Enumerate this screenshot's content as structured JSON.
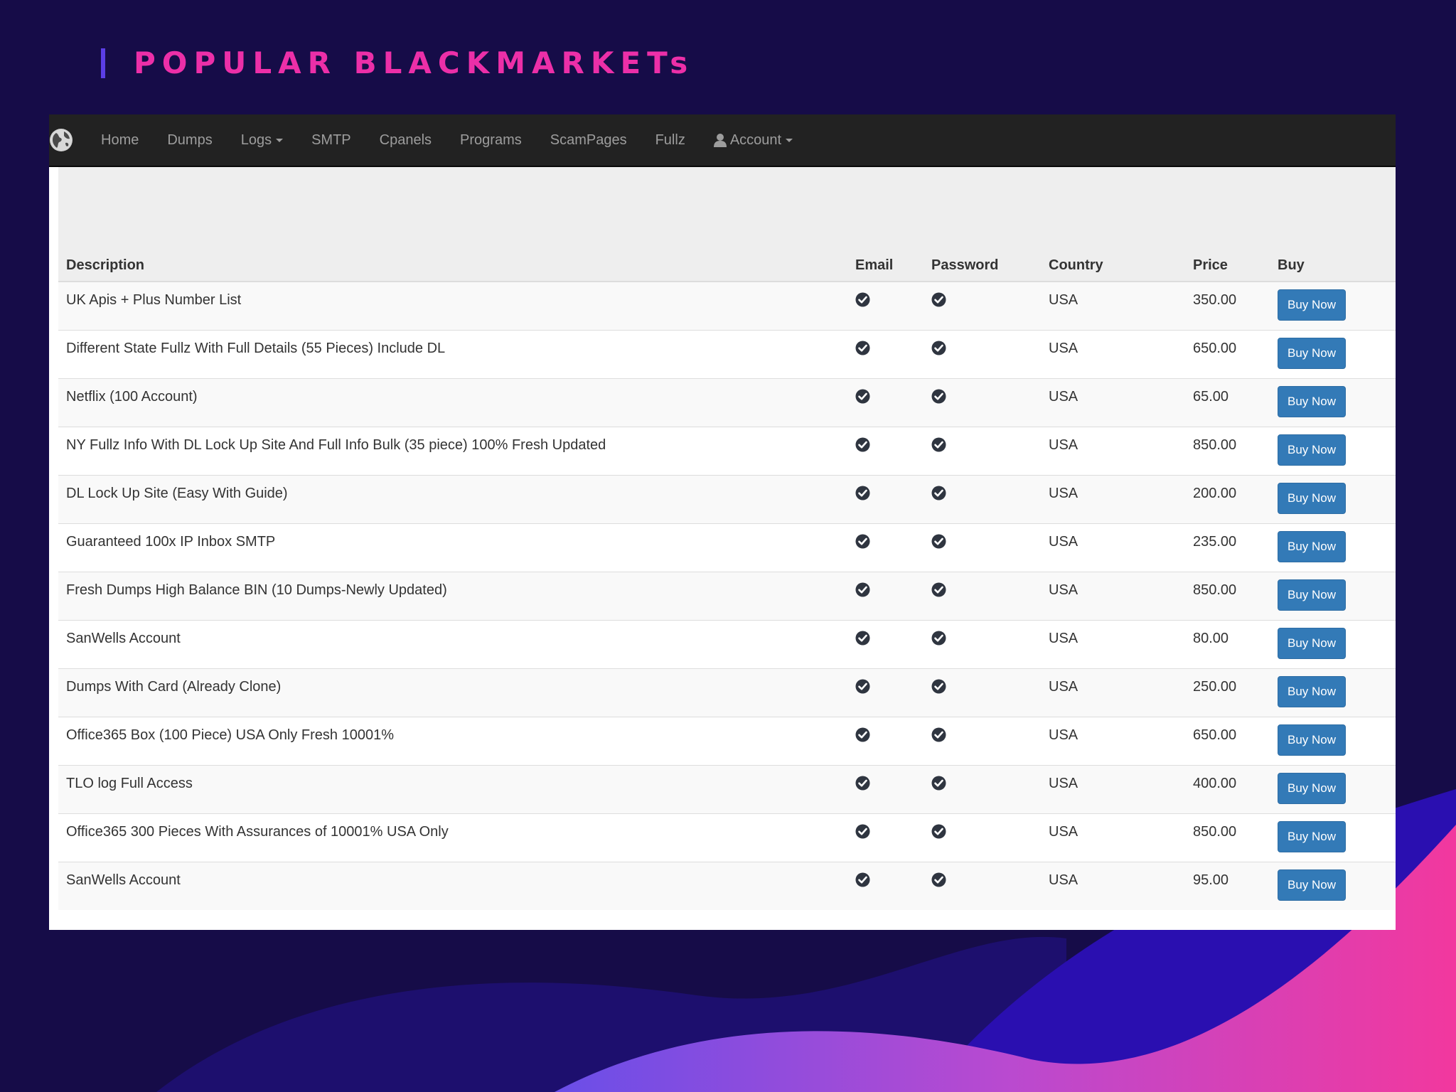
{
  "slide": {
    "title": "POPULAR BLACKMARKETs"
  },
  "colors": {
    "background": "#160c48",
    "title": "#ec2fa8",
    "navbar": "#222222",
    "button": "#337ab7"
  },
  "nav": {
    "items": [
      {
        "label": "Home"
      },
      {
        "label": "Dumps"
      },
      {
        "label": "Logs",
        "dropdown": true
      },
      {
        "label": "SMTP"
      },
      {
        "label": "Cpanels"
      },
      {
        "label": "Programs"
      },
      {
        "label": "ScamPages"
      },
      {
        "label": "Fullz"
      },
      {
        "label": "Account",
        "dropdown": true,
        "icon": "user-icon"
      }
    ]
  },
  "table": {
    "headers": {
      "description": "Description",
      "email": "Email",
      "password": "Password",
      "country": "Country",
      "price": "Price",
      "buy": "Buy"
    },
    "rows": [
      {
        "description": "UK Apis + Plus Number List",
        "country": "USA",
        "price": "350.00",
        "buy": "Buy Now"
      },
      {
        "description": "Different State Fullz With Full Details (55 Pieces) Include DL",
        "country": "USA",
        "price": "650.00",
        "buy": "Buy Now"
      },
      {
        "description": "Netflix (100 Account)",
        "country": "USA",
        "price": "65.00",
        "buy": "Buy Now"
      },
      {
        "description": "NY Fullz Info With DL Lock Up Site And Full Info Bulk (35 piece) 100% Fresh Updated",
        "country": "USA",
        "price": "850.00",
        "buy": "Buy Now"
      },
      {
        "description": "DL Lock Up Site (Easy With Guide)",
        "country": "USA",
        "price": "200.00",
        "buy": "Buy Now"
      },
      {
        "description": "Guaranteed 100x IP Inbox SMTP",
        "country": "USA",
        "price": "235.00",
        "buy": "Buy Now"
      },
      {
        "description": "Fresh Dumps High Balance BIN (10 Dumps-Newly Updated)",
        "country": "USA",
        "price": "850.00",
        "buy": "Buy Now"
      },
      {
        "description": "SanWells Account",
        "country": "USA",
        "price": "80.00",
        "buy": "Buy Now"
      },
      {
        "description": "Dumps With Card (Already Clone)",
        "country": "USA",
        "price": "250.00",
        "buy": "Buy Now"
      },
      {
        "description": "Office365 Box (100 Piece) USA Only Fresh 10001%",
        "country": "USA",
        "price": "650.00",
        "buy": "Buy Now"
      },
      {
        "description": "TLO log Full Access",
        "country": "USA",
        "price": "400.00",
        "buy": "Buy Now"
      },
      {
        "description": "Office365 300 Pieces With Assurances of 10001% USA Only",
        "country": "USA",
        "price": "850.00",
        "buy": "Buy Now"
      },
      {
        "description": "SanWells Account",
        "country": "USA",
        "price": "95.00",
        "buy": "Buy Now"
      }
    ]
  }
}
